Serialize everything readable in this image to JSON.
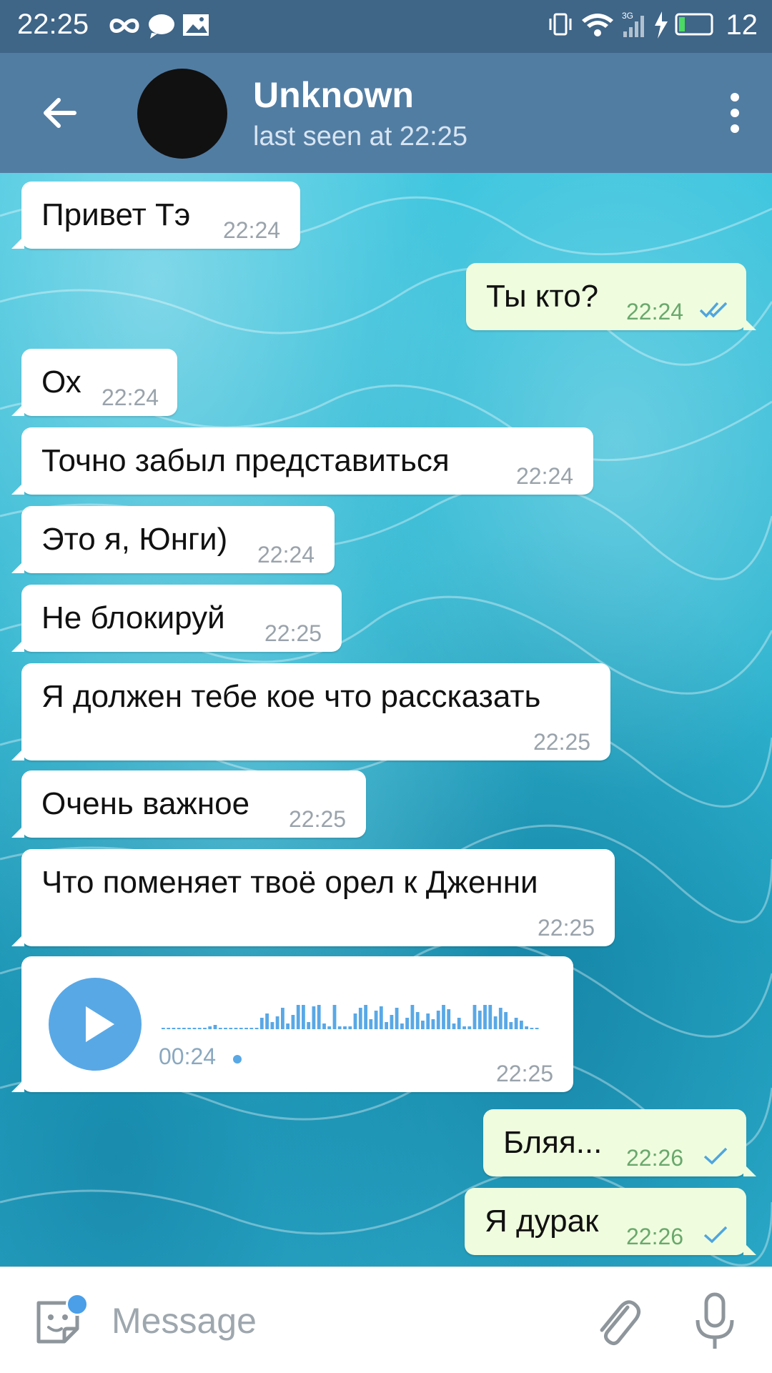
{
  "status_bar": {
    "time": "22:25",
    "network": "3G",
    "battery": "12"
  },
  "header": {
    "title": "Unknown",
    "subtitle": "last seen at 22:25"
  },
  "messages": [
    {
      "dir": "in",
      "text": "Привет Тэ",
      "time": "22:24"
    },
    {
      "dir": "out",
      "text": "Ты кто?",
      "time": "22:24",
      "status": "read"
    },
    {
      "dir": "in",
      "text": "Ох",
      "time": "22:24"
    },
    {
      "dir": "in",
      "text": "Точно забыл представиться",
      "time": "22:24"
    },
    {
      "dir": "in",
      "text": "Это я, Юнги)",
      "time": "22:24"
    },
    {
      "dir": "in",
      "text": "Не блокируй",
      "time": "22:25"
    },
    {
      "dir": "in",
      "text": "Я должен тебе кое что рассказать",
      "time": "22:25"
    },
    {
      "dir": "in",
      "text": "Очень важное",
      "time": "22:25"
    },
    {
      "dir": "in",
      "text": "Что поменяет твоё орел к Дженни",
      "time": "22:25"
    },
    {
      "dir": "in",
      "type": "voice",
      "duration": "00:24",
      "time": "22:25"
    },
    {
      "dir": "out",
      "text": "Бляя...",
      "time": "22:26",
      "status": "sent"
    },
    {
      "dir": "out",
      "text": "Я дурак",
      "time": "22:26",
      "status": "sent"
    }
  ],
  "input": {
    "placeholder": "Message"
  },
  "colors": {
    "header": "#527da3",
    "status_bar": "#3f6587",
    "incoming_bubble": "#ffffff",
    "outgoing_bubble": "#effdde",
    "accent": "#59a8e6"
  }
}
